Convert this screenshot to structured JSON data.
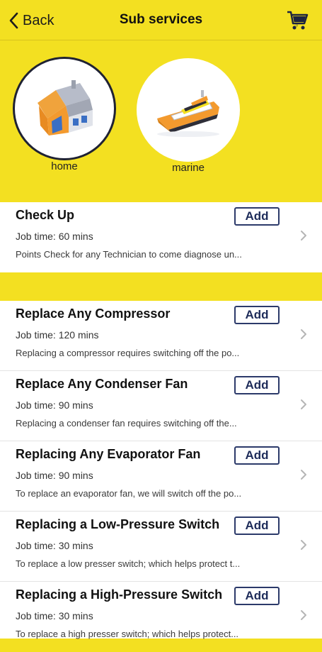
{
  "nav": {
    "back_label": "Back",
    "title": "Sub services"
  },
  "categories": [
    {
      "label": "home",
      "selected": true,
      "icon": "house-icon"
    },
    {
      "label": "marine",
      "selected": false,
      "icon": "boat-icon"
    }
  ],
  "first_group": [
    {
      "name": "Check Up",
      "time": "Job time: 60 mins",
      "desc": "Points Check for any Technician to come diagnose un...",
      "add_label": "Add"
    }
  ],
  "second_group": [
    {
      "name": "Replace Any Compressor",
      "time": "Job time: 120 mins",
      "desc": "Replacing a compressor requires switching off the po...",
      "add_label": "Add"
    },
    {
      "name": "Replace Any Condenser Fan",
      "time": "Job time: 90 mins",
      "desc": "Replacing a condenser fan requires switching off the...",
      "add_label": "Add"
    },
    {
      "name": "Replacing Any Evaporator Fan",
      "time": "Job time: 90 mins",
      "desc": "To replace an evaporator fan, we will switch off the po...",
      "add_label": "Add"
    },
    {
      "name": "Replacing a Low-Pressure Switch",
      "time": "Job time: 30 mins",
      "desc": "To replace a low presser switch; which helps protect t...",
      "add_label": "Add"
    },
    {
      "name": "Replacing a High-Pressure Switch",
      "time": "Job time: 30 mins",
      "desc": "To replace a high presser switch; which helps protect...",
      "add_label": "Add"
    }
  ],
  "colors": {
    "accent_yellow": "#f3e021",
    "button_navy": "#2c3a6a"
  }
}
